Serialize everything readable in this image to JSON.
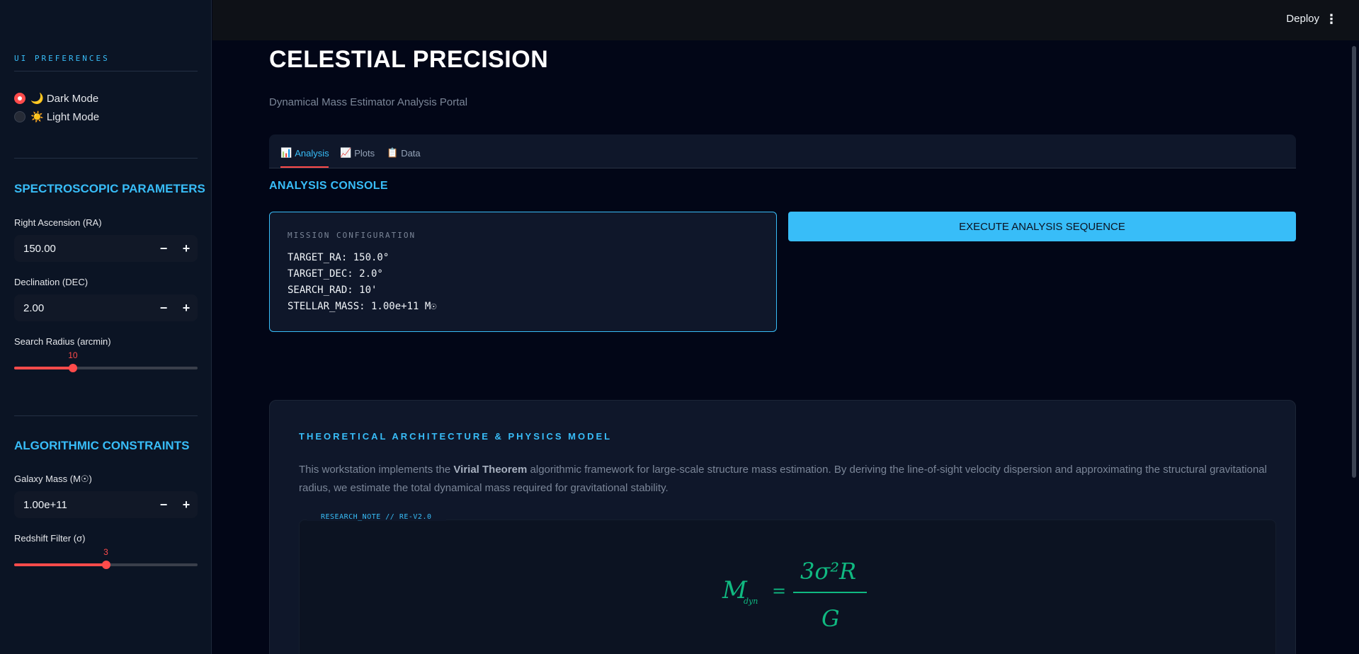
{
  "sidebar": {
    "caption": "UI PREFERENCES",
    "theme_options": [
      {
        "label": "🌙 Dark Mode",
        "selected": true
      },
      {
        "label": "☀️ Light Mode",
        "selected": false
      }
    ],
    "spectro_heading": "SPECTROSCOPIC PARAMETERS",
    "ra_label": "Right Ascension (RA)",
    "ra_value": "150.00",
    "dec_label": "Declination (DEC)",
    "dec_value": "2.00",
    "radius_label": "Search Radius (arcmin)",
    "radius_value": "10",
    "radius_level": 0.32,
    "algo_heading": "ALGORITHMIC CONSTRAINTS",
    "mass_label": "Galaxy Mass (M☉)",
    "mass_value": "1.00e+11",
    "redshift_label": "Redshift Filter (σ)",
    "redshift_value": "3",
    "redshift_level": 0.5,
    "minus": "−",
    "plus": "+"
  },
  "header": {
    "deploy_label": "Deploy",
    "menu_icon": "⋮"
  },
  "main": {
    "title": "CELESTIAL PRECISION",
    "subtitle": "Dynamical Mass Estimator Analysis Portal",
    "tabs": [
      {
        "icon": "📊",
        "label": "Analysis",
        "active": true
      },
      {
        "icon": "📈",
        "label": "Plots",
        "active": false
      },
      {
        "icon": "📋",
        "label": "Data",
        "active": false
      }
    ],
    "console_heading": "ANALYSIS CONSOLE",
    "config": {
      "caption": "MISSION CONFIGURATION",
      "lines": [
        "TARGET_RA: 150.0°",
        "TARGET_DEC: 2.0°",
        "SEARCH_RAD: 10'",
        "STELLAR_MASS: 1.00e+11 M☉"
      ]
    },
    "execute_label": "EXECUTE ANALYSIS SEQUENCE",
    "theory": {
      "heading": "THEORETICAL ARCHITECTURE & PHYSICS MODEL",
      "text_pre": "This workstation implements the ",
      "text_bold": "Virial Theorem",
      "text_post": " algorithmic framework for large-scale structure mass estimation. By deriving the line-of-sight velocity dispersion and approximating the structural gravitational radius, we estimate the total dynamical mass required for gravitational stability.",
      "note_tag": "RESEARCH_NOTE // RE-V2.0",
      "formula": {
        "lhs": "M",
        "lhs_sub": "dyn",
        "eq": "=",
        "numerator": "3σ²R",
        "denominator": "G"
      }
    }
  },
  "colors": {
    "accent": "#38bdf8",
    "slider": "#ff4b4b",
    "formula": "#10b981"
  }
}
